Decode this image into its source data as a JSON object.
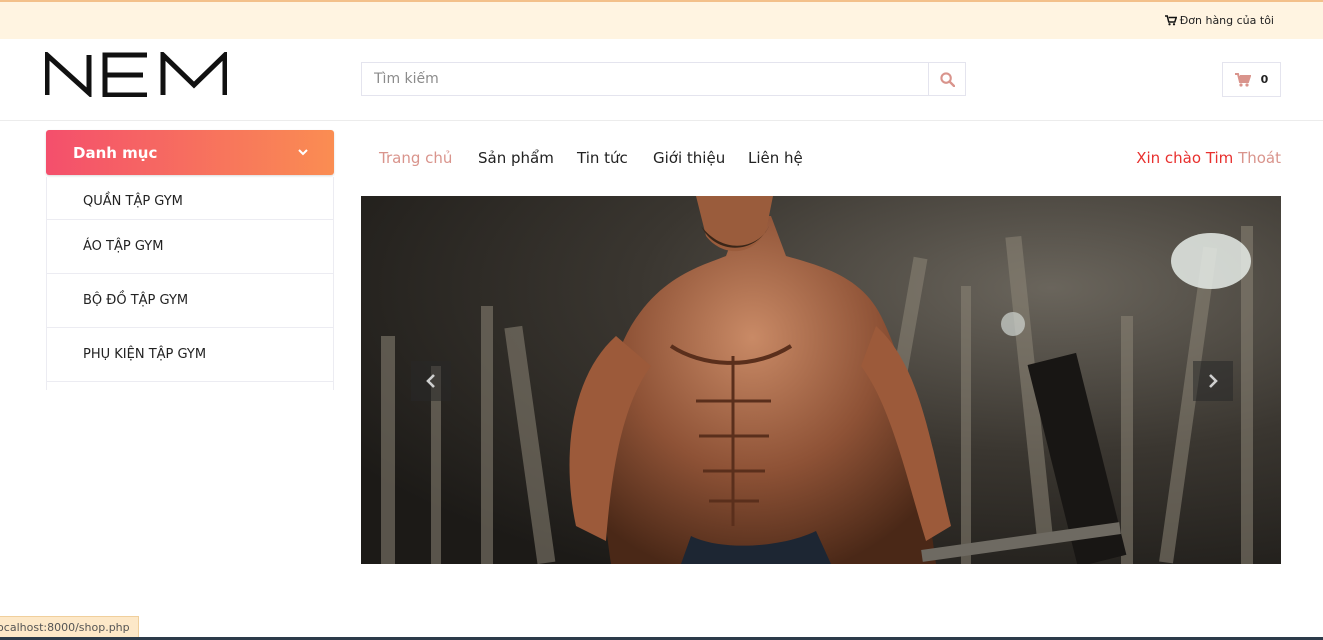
{
  "topbar": {
    "orders_label": "Đơn hàng của tôi",
    "icon": "cart-icon"
  },
  "header": {
    "logo_text": "NEM",
    "search": {
      "placeholder": "Tìm kiếm",
      "value": "",
      "icon": "search-icon"
    },
    "cart": {
      "count": "0",
      "icon": "cart-icon"
    }
  },
  "sidebar": {
    "title": "Danh mục",
    "items": [
      {
        "label": "QUẦN TẬP GYM"
      },
      {
        "label": "ÁO TẬP GYM"
      },
      {
        "label": "BỘ ĐỒ TẬP GYM"
      },
      {
        "label": "PHỤ KIỆN TẬP GYM"
      }
    ]
  },
  "nav": {
    "items": [
      {
        "label": "Trang chủ",
        "active": true
      },
      {
        "label": "Sản phẩm"
      },
      {
        "label": "Tin tức"
      },
      {
        "label": "Giới thiệu"
      },
      {
        "label": "Liên hệ"
      }
    ],
    "greeting": "Xin chào Tim",
    "logout": "Thoát"
  },
  "slider": {
    "prev_icon": "chevron-left-icon",
    "next_icon": "chevron-right-icon"
  },
  "statusbar": {
    "url": "localhost:8000/shop.php"
  },
  "colors": {
    "topbar_bg": "#fff4e1",
    "accent_start": "#f44f6c",
    "accent_end": "#fa8d52",
    "nav_active": "#d9948c",
    "greeting": "#e8302e"
  }
}
